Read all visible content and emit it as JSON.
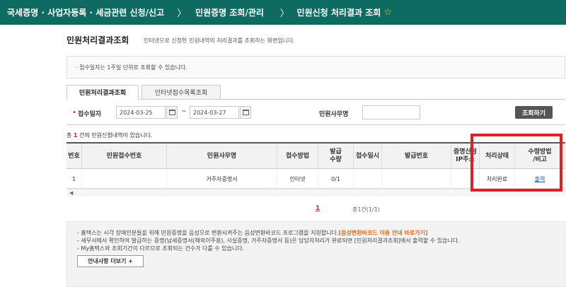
{
  "breadcrumb": {
    "items": [
      "국세증명 · 사업자등록 · 세금관련 신청/신고",
      "민원증명 조회/관리",
      "민원신청 처리결과 조회"
    ],
    "separator": "〉",
    "favorite_icon": "star-icon"
  },
  "page": {
    "title": "민원처리결과조회",
    "description": "인터넷으로 신청한 민원내역의 처리결과를 조회하는 화면입니다."
  },
  "info": "· 접수일자는 1주일 단위로 조회할 수 있습니다.",
  "tabs": [
    {
      "label": "민원처리결과조회",
      "active": true
    },
    {
      "label": "인터넷접수목록조회",
      "active": false
    }
  ],
  "search": {
    "required_mark": "•",
    "date_label": "접수일자",
    "date_from": "2024-03-25",
    "date_to": "2024-03-27",
    "date_sep": "~",
    "office_label": "민원사무명",
    "office_value": "",
    "button": "조회하기"
  },
  "result": {
    "prefix": "총",
    "count": "1",
    "suffix": "건의 민원신청내역이 있습니다."
  },
  "table": {
    "headers": [
      "번호",
      "민원접수번호",
      "민원사무명",
      "접수방법",
      "발급\n수량",
      "접수일시",
      "발급번호",
      "증명신청\nIP주소",
      "처리상태",
      "수령방법\n/비고"
    ],
    "rows": [
      [
        "1",
        "",
        "거주자증명서",
        "인터넷",
        "0/1",
        "",
        "",
        "",
        "처리완료",
        "출력"
      ]
    ]
  },
  "highlight_color": "#e31f26",
  "pagination": {
    "current": "1",
    "total_text": "총1건(1/1)"
  },
  "notice": {
    "line1": "- 홈택스는 시각 장애인분들을 위해 민원증명을 음성으로 변환시켜주는 음성변환바코드 프로그램을 지원합니다.",
    "line1_link": "[음성변환바코드 이용 안내 바로가기]",
    "line2": "- 세무서에서 확인하여 발급하는 증명(납세증명서(해외이주용), 사실증명, 거주자증명서 등)은 담당자처리가 완료되면 [민원처리결과조회]에서 출력할 수 있습니다.",
    "line3": "- My홈택스와 조회기간이 다르므로 조회되는 건수가 다를 수 있습니다.",
    "button": "안내사항 더보기 +"
  }
}
